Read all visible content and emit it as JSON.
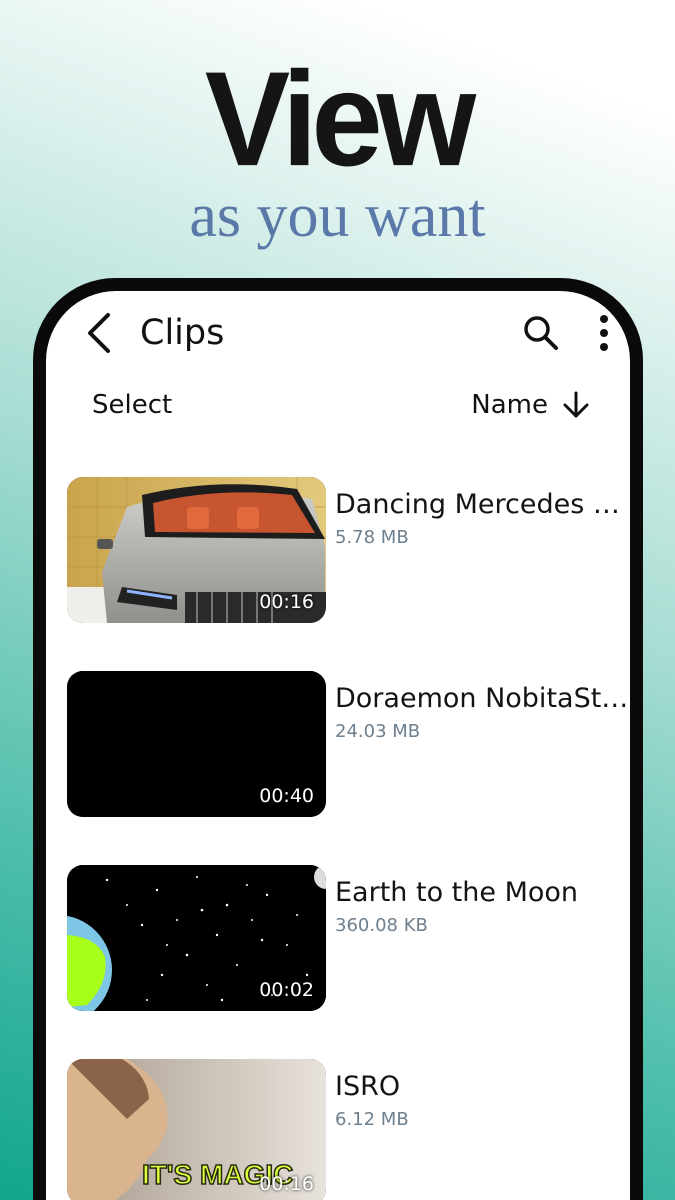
{
  "promo": {
    "headline": "View",
    "subheadline": "as you want"
  },
  "header": {
    "title": "Clips",
    "back_icon": "chevron-left-icon",
    "search_icon": "search-icon",
    "more_icon": "more-vertical-icon"
  },
  "toolbar": {
    "select_label": "Select",
    "sort_label": "Name",
    "sort_icon": "arrow-down-icon"
  },
  "videos": [
    {
      "name": "Dancing Mercedes G...",
      "size": "5.78 MB",
      "duration": "00:16"
    },
    {
      "name": "Doraemon NobitaSte...",
      "size": "24.03 MB",
      "duration": "00:40"
    },
    {
      "name": "Earth to the Moon",
      "size": "360.08 KB",
      "duration": "00:02"
    },
    {
      "name": "ISRO",
      "size": "6.12 MB",
      "duration": "00:16",
      "thumbnail_caption": "IT'S MAGIC"
    }
  ],
  "colors": {
    "subheadline": "#5b79a8",
    "background_gradient_end": "#12a58e",
    "phone_frame": "#0a0a0a",
    "file_size_text": "#6e7f8e"
  }
}
